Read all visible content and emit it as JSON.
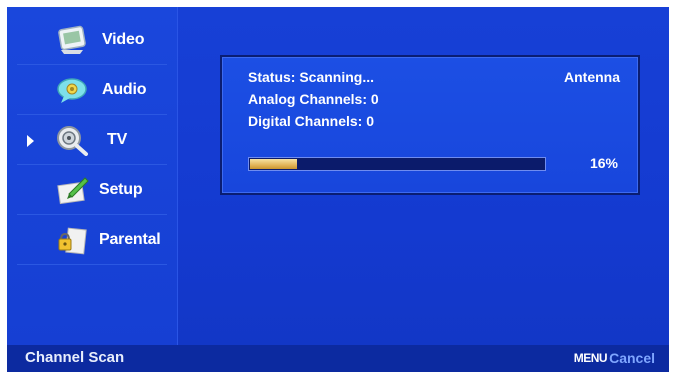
{
  "sidebar": {
    "items": [
      {
        "label": "Video",
        "icon": "video-icon"
      },
      {
        "label": "Audio",
        "icon": "audio-icon"
      },
      {
        "label": "TV",
        "icon": "tv-icon",
        "selected": true
      },
      {
        "label": "Setup",
        "icon": "setup-icon"
      },
      {
        "label": "Parental",
        "icon": "parental-icon"
      }
    ]
  },
  "scan": {
    "status": "Status: Scanning...",
    "analog": "Analog Channels: 0",
    "digital": "Digital Channels: 0",
    "source": "Antenna",
    "progress_percent": 16,
    "progress_label": "16%"
  },
  "footer": {
    "title": "Channel Scan",
    "menu_key": "MENU",
    "cancel_label": "Cancel"
  },
  "colors": {
    "background": "#143ad0",
    "footer": "#0c2aa0",
    "progress_fill": "#e2b55a",
    "progress_track": "#0b1b6b",
    "cancel": "#7fa6ff"
  }
}
